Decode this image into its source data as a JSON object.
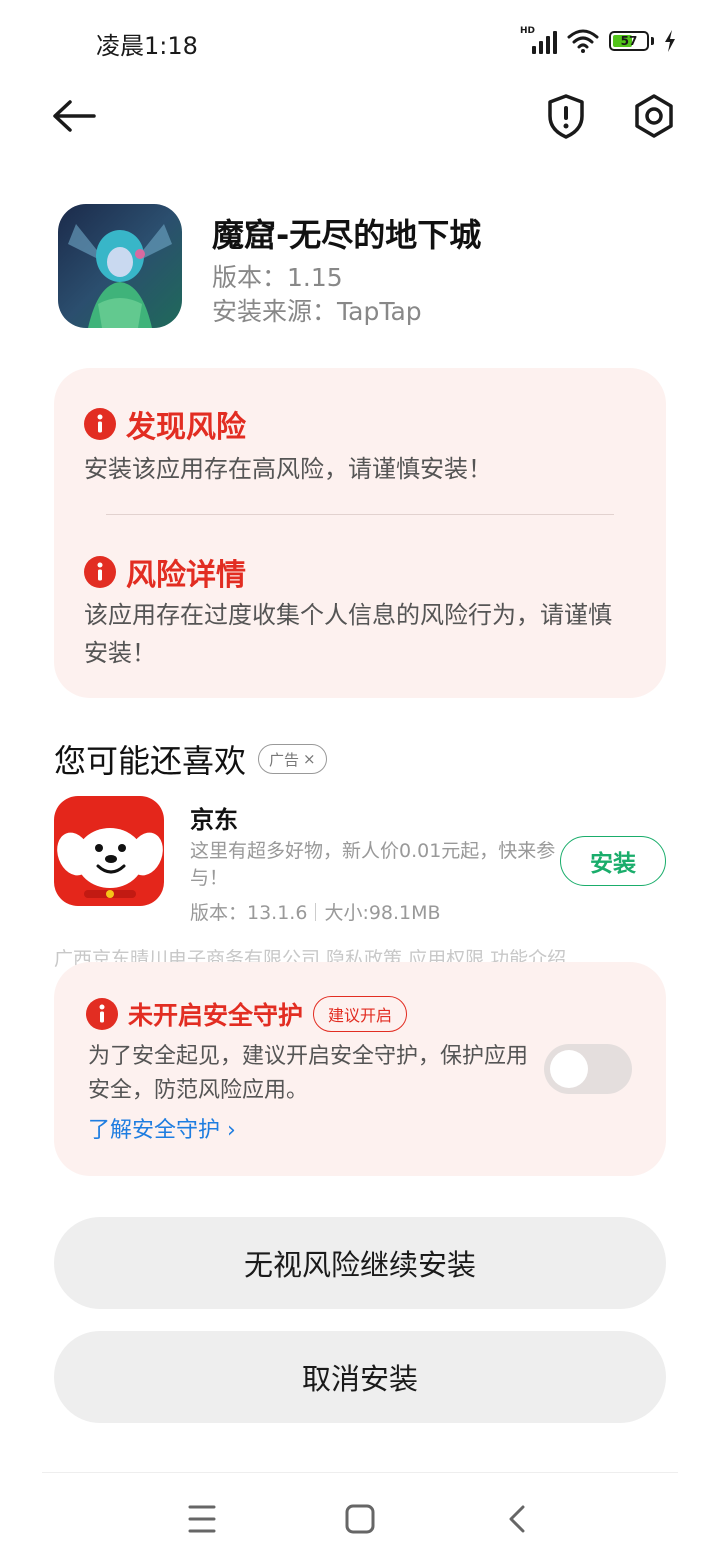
{
  "status_bar": {
    "time": "凌晨1:18",
    "network_label": "HD",
    "battery": "57"
  },
  "app": {
    "name": "魔窟-无尽的地下城",
    "version": "版本：1.15",
    "source": "安装来源：TapTap"
  },
  "risk_card": {
    "found_title": "发现风险",
    "found_text": "安装该应用存在高风险，请谨慎安装！",
    "detail_title": "风险详情",
    "detail_text": "该应用存在过度收集个人信息的风险行为，请谨慎安装！"
  },
  "recommend": {
    "title": "您可能还喜欢",
    "ad_label": "广告",
    "ad_close": "×",
    "item": {
      "name": "京东",
      "desc": "这里有超多好物，新人价0.01元起，快来参与！",
      "version": "版本：13.1.6",
      "size": "大小:98.1MB",
      "install_label": "安装",
      "links": "广西京东晴川电子商务有限公司  隐私政策  应用权限  功能介绍"
    }
  },
  "protect_card": {
    "title": "未开启安全守护",
    "badge": "建议开启",
    "text": "为了安全起见，建议开启安全守护，保护应用安全，防范风险应用。",
    "link": "了解安全守护 ›",
    "toggle_on": false
  },
  "actions": {
    "continue_label": "无视风险继续安装",
    "cancel_label": "取消安装"
  },
  "colors": {
    "risk_red": "#e22d22",
    "card_bg": "#fdf1ef",
    "install_green": "#1aad6b",
    "link_blue": "#1e7de0"
  }
}
